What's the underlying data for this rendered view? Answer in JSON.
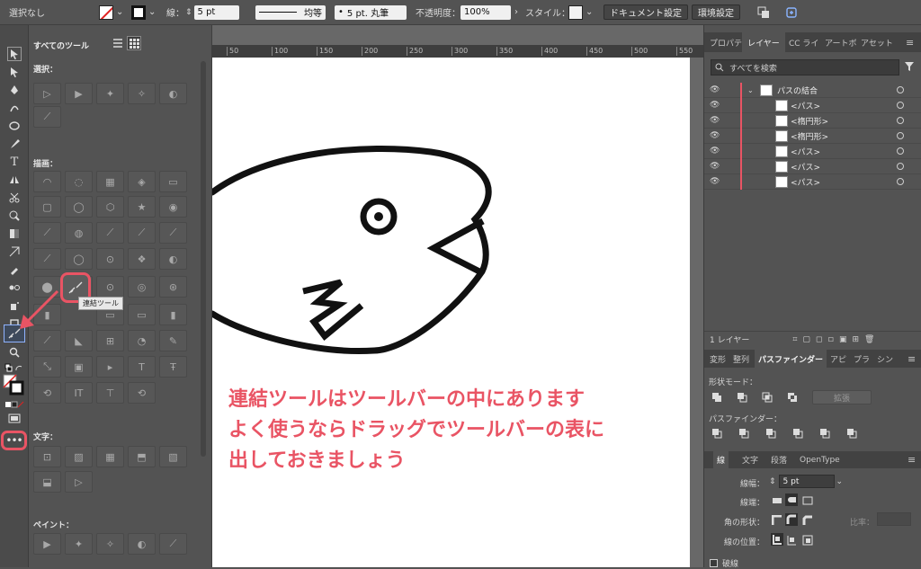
{
  "control_bar": {
    "selection_status": "選択なし",
    "stroke_label": "線：",
    "stroke_weight": "5 pt",
    "profile_label": "均等",
    "brush_label": "5 pt. 丸筆",
    "opacity_label": "不透明度：",
    "opacity_value": "100%",
    "style_label": "スタイル：",
    "doc_settings_button": "ドキュメント設定",
    "prefs_button": "環境設定"
  },
  "tool_panel": {
    "title": "すべてのツール",
    "sections": {
      "select": "選択：",
      "draw": "描画：",
      "type": "文字：",
      "paint": "ペイント："
    },
    "tooltip": "連結ツール"
  },
  "ruler": {
    "ticks": [
      "50",
      "100",
      "150",
      "200",
      "250",
      "300",
      "350",
      "400",
      "450",
      "500",
      "550"
    ]
  },
  "annotation": {
    "line1": "連結ツールはツールバーの中にあります",
    "line2": "よく使うならドラッグでツールバーの表に",
    "line3": "出しておきましょう"
  },
  "right_panel": {
    "top_tabs": [
      "プロパテ",
      "レイヤー",
      "CC ライ",
      "アートボ",
      "アセット"
    ],
    "layers": {
      "search_placeholder": "すべてを検索",
      "group_name": "パスの結合",
      "items": [
        "<パス>",
        "<楕円形>",
        "<楕円形>",
        "<パス>",
        "<パス>",
        "<パス>"
      ],
      "footer_count": "1 レイヤー"
    },
    "mid_tabs": [
      "変形",
      "整列",
      "パスファインダー",
      "アピ",
      "プラ",
      "シン"
    ],
    "pathfinder": {
      "shape_mode_label": "形状モード：",
      "expand_button": "拡張",
      "pathfinder_label": "パスファインダー："
    },
    "stroke_tabs": [
      "線",
      "文字",
      "段落",
      "OpenType"
    ],
    "stroke": {
      "weight_label": "線幅：",
      "weight_value": "5 pt",
      "cap_label": "線端：",
      "corner_label": "角の形状：",
      "limit_label": "比率：",
      "align_label": "線の位置：",
      "dashed_label": "破線"
    }
  },
  "colors": {
    "accent_red": "#e95464",
    "panel_bg": "#535353",
    "artboard": "#ffffff"
  }
}
